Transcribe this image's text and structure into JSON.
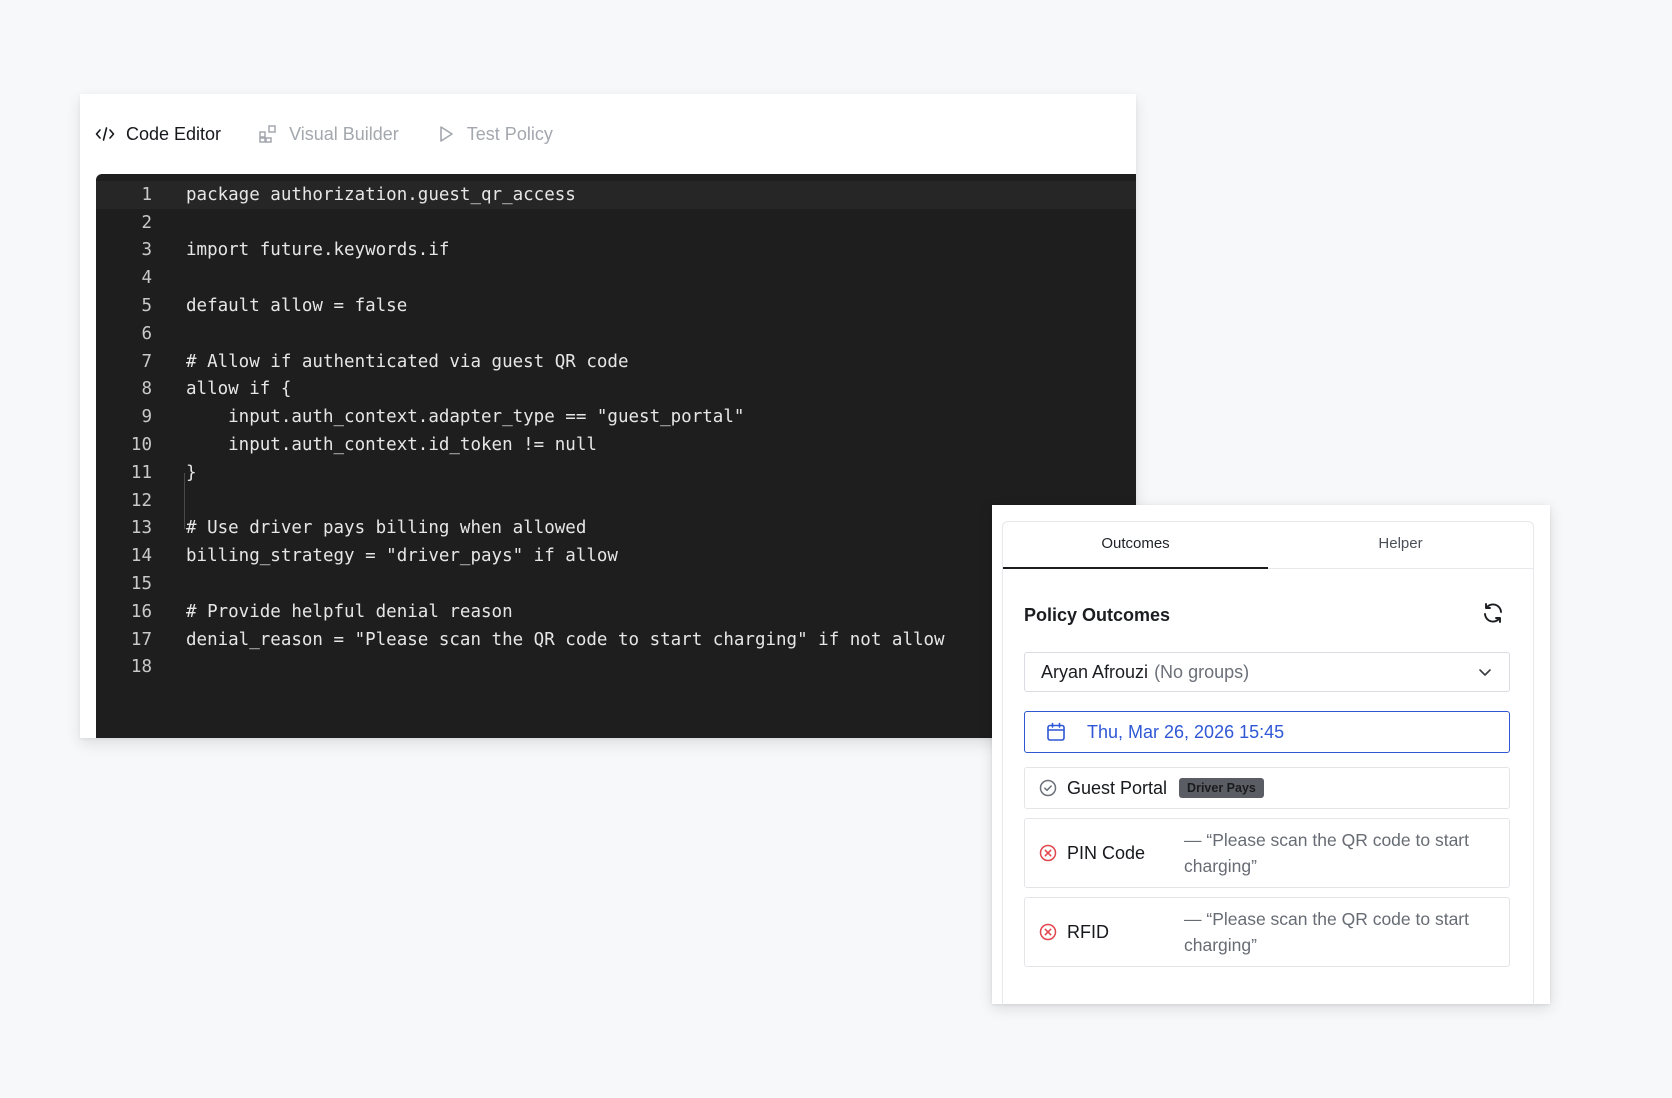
{
  "editor": {
    "tabs": [
      {
        "label": "Code Editor",
        "icon": "code-icon",
        "active": true
      },
      {
        "label": "Visual Builder",
        "icon": "blocks-icon",
        "active": false
      },
      {
        "label": "Test Policy",
        "icon": "play-icon",
        "active": false
      }
    ],
    "lines": [
      {
        "n": "1",
        "text": "package authorization.guest_qr_access"
      },
      {
        "n": "2",
        "text": ""
      },
      {
        "n": "3",
        "text": "import future.keywords.if"
      },
      {
        "n": "4",
        "text": ""
      },
      {
        "n": "5",
        "text": "default allow = false"
      },
      {
        "n": "6",
        "text": ""
      },
      {
        "n": "7",
        "text": "# Allow if authenticated via guest QR code"
      },
      {
        "n": "8",
        "text": "allow if {"
      },
      {
        "n": "9",
        "text": "    input.auth_context.adapter_type == \"guest_portal\""
      },
      {
        "n": "10",
        "text": "    input.auth_context.id_token != null"
      },
      {
        "n": "11",
        "text": "}"
      },
      {
        "n": "12",
        "text": ""
      },
      {
        "n": "13",
        "text": "# Use driver pays billing when allowed"
      },
      {
        "n": "14",
        "text": "billing_strategy = \"driver_pays\" if allow"
      },
      {
        "n": "15",
        "text": ""
      },
      {
        "n": "16",
        "text": "# Provide helpful denial reason"
      },
      {
        "n": "17",
        "text": "denial_reason = \"Please scan the QR code to start charging\" if not allow"
      },
      {
        "n": "18",
        "text": ""
      }
    ]
  },
  "outcomes": {
    "tabs": [
      {
        "label": "Outcomes",
        "active": true
      },
      {
        "label": "Helper",
        "active": false
      }
    ],
    "title": "Policy Outcomes",
    "user": {
      "name": "Aryan Afrouzi",
      "groups": "(No groups)"
    },
    "datetime": "Thu, Mar 26, 2026 15:45",
    "results": [
      {
        "name": "Guest Portal",
        "status": "allowed",
        "badge": "Driver Pays",
        "reason": ""
      },
      {
        "name": "PIN Code",
        "status": "denied",
        "badge": "",
        "reason": "— “Please scan the QR code to start charging”"
      },
      {
        "name": "RFID",
        "status": "denied",
        "badge": "",
        "reason": "— “Please scan the QR code to start charging”"
      }
    ],
    "colors": {
      "accent": "#2f57d6",
      "denied": "#e0464b",
      "allowed": "#6b7079"
    }
  }
}
